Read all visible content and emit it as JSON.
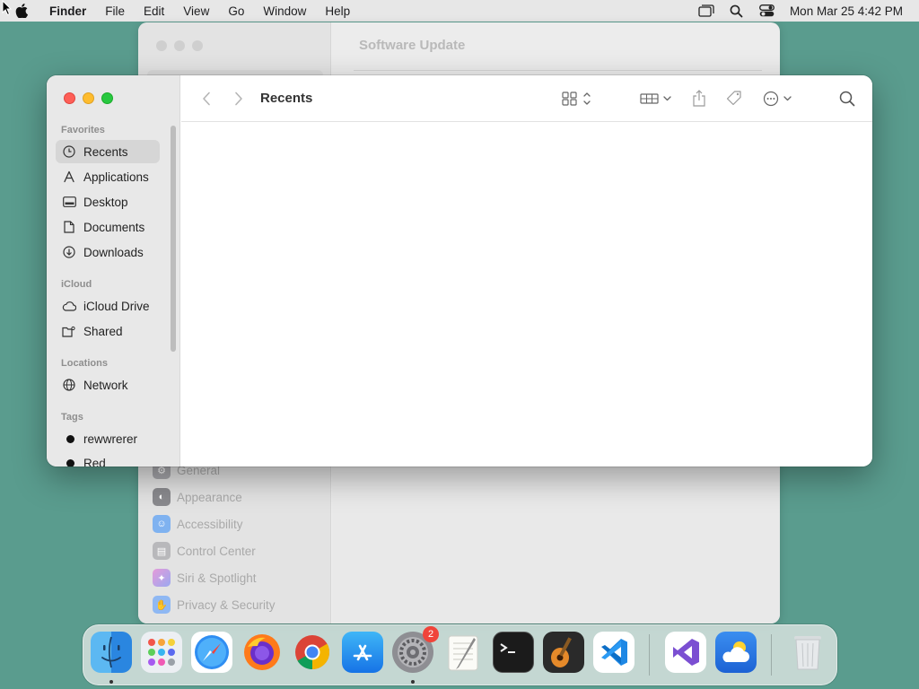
{
  "menubar": {
    "app_name": "Finder",
    "menus": [
      "File",
      "Edit",
      "View",
      "Go",
      "Window",
      "Help"
    ],
    "clock": "Mon Mar 25  4:42 PM"
  },
  "background_window": {
    "title": "Software Update",
    "sidebar_items": [
      {
        "label": "General",
        "icon": "gear-icon",
        "color": "#8e8e93"
      },
      {
        "label": "Appearance",
        "icon": "appearance-icon",
        "color": "#1c1c1e"
      },
      {
        "label": "Accessibility",
        "icon": "accessibility-icon",
        "color": "#0a84ff"
      },
      {
        "label": "Control Center",
        "icon": "control-center-icon",
        "color": "#8e8e93"
      },
      {
        "label": "Siri & Spotlight",
        "icon": "siri-icon",
        "color": "#c84bd1"
      },
      {
        "label": "Privacy & Security",
        "icon": "hand-icon",
        "color": "#3b82f6"
      }
    ]
  },
  "finder": {
    "title": "Recents",
    "sections": {
      "favorites": "Favorites",
      "icloud": "iCloud",
      "locations": "Locations",
      "tags": "Tags"
    },
    "favorites": [
      "Recents",
      "Applications",
      "Desktop",
      "Documents",
      "Downloads"
    ],
    "icloud": [
      "iCloud Drive",
      "Shared"
    ],
    "locations": [
      "Network"
    ],
    "tags": [
      "rewwrerer",
      "Red"
    ]
  },
  "dock": {
    "apps": [
      "Finder",
      "Launchpad",
      "Safari",
      "Firefox",
      "Chrome",
      "App Store",
      "System Settings",
      "TextEdit",
      "Terminal",
      "GarageBand",
      "Visual Studio Code",
      "Visual Studio",
      "Weather",
      "Trash"
    ],
    "settings_badge": "2"
  },
  "colors": {
    "desktop": "#5a9c8e",
    "close": "#fe5f57",
    "minimize": "#febc2e",
    "zoom": "#28c840",
    "badge": "#f0443a"
  }
}
